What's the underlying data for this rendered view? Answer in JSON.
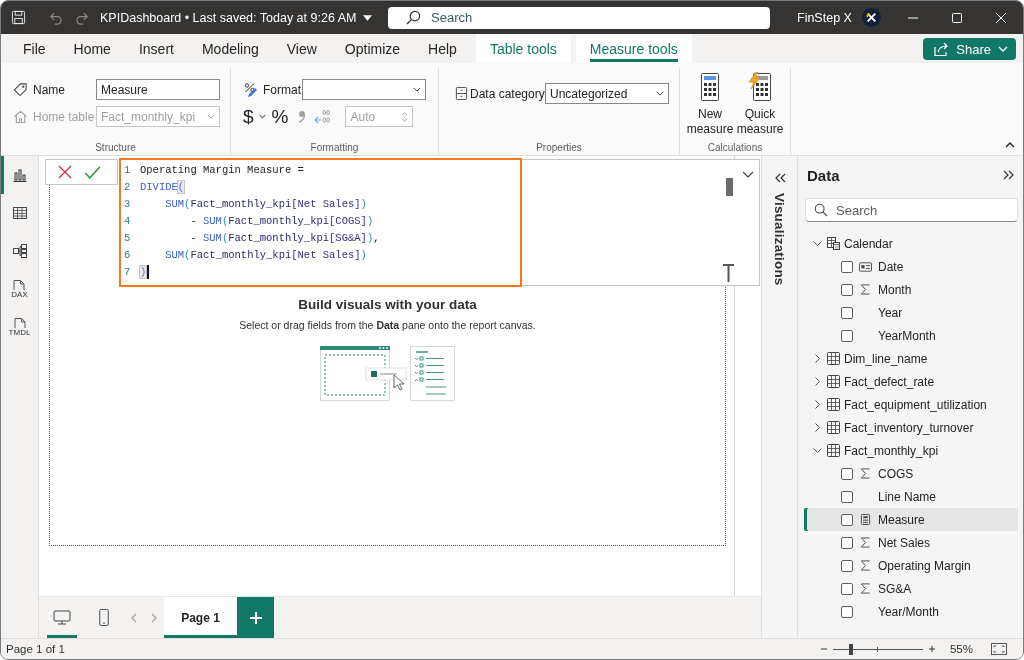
{
  "title_bar": {
    "quick_access": [
      {
        "kind": "save",
        "disabled": false
      },
      {
        "kind": "undo",
        "disabled": true
      },
      {
        "kind": "redo",
        "disabled": true
      }
    ],
    "title": "KPIDashboard • Last saved: Today at 9:26 AM",
    "search": {
      "placeholder": "Search"
    },
    "user": "FinStep X"
  },
  "tabs": [
    {
      "label": "File",
      "contextual": false,
      "selected": false
    },
    {
      "label": "Home",
      "contextual": false,
      "selected": false
    },
    {
      "label": "Insert",
      "contextual": false,
      "selected": false
    },
    {
      "label": "Modeling",
      "contextual": false,
      "selected": false
    },
    {
      "label": "View",
      "contextual": false,
      "selected": false
    },
    {
      "label": "Optimize",
      "contextual": false,
      "selected": false
    },
    {
      "label": "Help",
      "contextual": false,
      "selected": false
    },
    {
      "label": "Table tools",
      "contextual": true,
      "selected": false
    },
    {
      "label": "Measure tools",
      "contextual": true,
      "selected": true
    }
  ],
  "share_button": {
    "label": "Share"
  },
  "ribbon": {
    "structure": {
      "label": "Structure",
      "name_field": {
        "label": "Name",
        "value": "Measure",
        "disabled": false
      },
      "home_table": {
        "label": "Home table",
        "value": "Fact_monthly_kpi",
        "disabled": true
      }
    },
    "formatting": {
      "label": "Formatting",
      "format_field": {
        "label": "Format"
      },
      "buttons": [
        {
          "kind": "currency",
          "label": "$",
          "disabled": false
        },
        {
          "kind": "percent",
          "label": "%",
          "disabled": false
        },
        {
          "kind": "comma",
          "disabled": true
        },
        {
          "kind": "decimal",
          "disabled": true
        }
      ],
      "decimal_places": {
        "placeholder": "Auto",
        "disabled": true
      }
    },
    "properties": {
      "label": "Properties",
      "data_category": {
        "label": "Data category",
        "value": "Uncategorized"
      }
    },
    "calculations": {
      "label": "Calculations",
      "buttons": [
        {
          "kind": "new",
          "label": "New measure"
        },
        {
          "kind": "quick",
          "label": "Quick measure"
        }
      ]
    }
  },
  "views": [
    {
      "kind": "report",
      "selected": true
    },
    {
      "kind": "table",
      "selected": false
    },
    {
      "kind": "model",
      "selected": false
    },
    {
      "kind": "dax",
      "badge": "DAX",
      "selected": false
    },
    {
      "kind": "tmdl",
      "badge": "TMDL",
      "selected": false
    }
  ],
  "formula_bar": {
    "lines": [
      {
        "number": "1",
        "cursor": false,
        "tokens": [
          {
            "text": "Operating Margin Measure =",
            "kind": "text"
          }
        ]
      },
      {
        "number": "2",
        "cursor": false,
        "tokens": [
          {
            "text": "DIVIDE",
            "kind": "function"
          },
          {
            "text": "(",
            "kind": "match"
          }
        ]
      },
      {
        "number": "3",
        "cursor": false,
        "tokens": [
          {
            "text": "    SUM",
            "kind": "function"
          },
          {
            "text": "(",
            "kind": "paren"
          },
          {
            "text": "Fact_monthly_kpi",
            "kind": "table"
          },
          {
            "text": "[Net Sales]",
            "kind": "column"
          },
          {
            "text": ")",
            "kind": "paren"
          }
        ]
      },
      {
        "number": "4",
        "cursor": false,
        "tokens": [
          {
            "text": "        - ",
            "kind": "text"
          },
          {
            "text": "SUM",
            "kind": "function"
          },
          {
            "text": "(",
            "kind": "paren"
          },
          {
            "text": "Fact_monthly_kpi",
            "kind": "table"
          },
          {
            "text": "[COGS]",
            "kind": "column"
          },
          {
            "text": ")",
            "kind": "paren"
          }
        ]
      },
      {
        "number": "5",
        "cursor": false,
        "tokens": [
          {
            "text": "        - ",
            "kind": "text"
          },
          {
            "text": "SUM",
            "kind": "function"
          },
          {
            "text": "(",
            "kind": "paren"
          },
          {
            "text": "Fact_monthly_kpi",
            "kind": "table"
          },
          {
            "text": "[SG&A]",
            "kind": "column"
          },
          {
            "text": ")",
            "kind": "paren"
          },
          {
            "text": ",",
            "kind": "text"
          }
        ]
      },
      {
        "number": "6",
        "cursor": false,
        "tokens": [
          {
            "text": "    SUM",
            "kind": "function"
          },
          {
            "text": "(",
            "kind": "paren"
          },
          {
            "text": "Fact_monthly_kpi",
            "kind": "table"
          },
          {
            "text": "[Net Sales]",
            "kind": "column"
          },
          {
            "text": ")",
            "kind": "paren"
          }
        ]
      },
      {
        "number": "7",
        "cursor": true,
        "tokens": [
          {
            "text": ")",
            "kind": "match"
          }
        ]
      }
    ]
  },
  "canvas": {
    "title": "Build visuals with your data",
    "text": "Select or drag fields from the **Data** pane onto the report canvas."
  },
  "visualizations_pane": {
    "title": "Visualizations"
  },
  "data_pane": {
    "title": "Data",
    "search": {
      "placeholder": "Search"
    },
    "tree": [
      {
        "label": "Calendar",
        "kind": "calendar",
        "expanded": true,
        "selected": false,
        "children": [
          {
            "label": "Date",
            "kind": "key",
            "checked": false,
            "selected": false
          },
          {
            "label": "Month",
            "kind": "sum",
            "checked": false,
            "selected": false
          },
          {
            "label": "Year",
            "kind": "plain",
            "checked": false,
            "selected": false
          },
          {
            "label": "YearMonth",
            "kind": "plain",
            "checked": false,
            "selected": false
          }
        ]
      },
      {
        "label": "Dim_line_name",
        "kind": "table",
        "expanded": false,
        "selected": false
      },
      {
        "label": "Fact_defect_rate",
        "kind": "table",
        "expanded": false,
        "selected": false
      },
      {
        "label": "Fact_equipment_utilization",
        "kind": "table",
        "expanded": false,
        "selected": false
      },
      {
        "label": "Fact_inventory_turnover",
        "kind": "table",
        "expanded": false,
        "selected": false
      },
      {
        "label": "Fact_monthly_kpi",
        "kind": "table",
        "expanded": true,
        "selected": false,
        "children": [
          {
            "label": "COGS",
            "kind": "sum",
            "checked": false,
            "selected": false
          },
          {
            "label": "Line Name",
            "kind": "plain",
            "checked": false,
            "selected": false
          },
          {
            "label": "Measure",
            "kind": "measure",
            "checked": false,
            "selected": true
          },
          {
            "label": "Net Sales",
            "kind": "sum",
            "checked": false,
            "selected": false
          },
          {
            "label": "Operating Margin",
            "kind": "sum",
            "checked": false,
            "selected": false
          },
          {
            "label": "SG&A",
            "kind": "sum",
            "checked": false,
            "selected": false
          },
          {
            "label": "Year/Month",
            "kind": "plain",
            "checked": false,
            "selected": false
          }
        ]
      }
    ]
  },
  "page_bar": {
    "layout_views": [
      {
        "kind": "desktop",
        "selected": true
      },
      {
        "kind": "mobile",
        "selected": false
      }
    ],
    "nav_buttons": [
      {
        "kind": "previous",
        "disabled": true
      },
      {
        "kind": "next",
        "disabled": true
      }
    ],
    "pages": [
      {
        "label": "Page 1",
        "selected": true
      }
    ]
  },
  "status_bar": {
    "page_info": "Page 1 of 1",
    "zoom": {
      "level": 0.2,
      "reading": "55%"
    }
  }
}
